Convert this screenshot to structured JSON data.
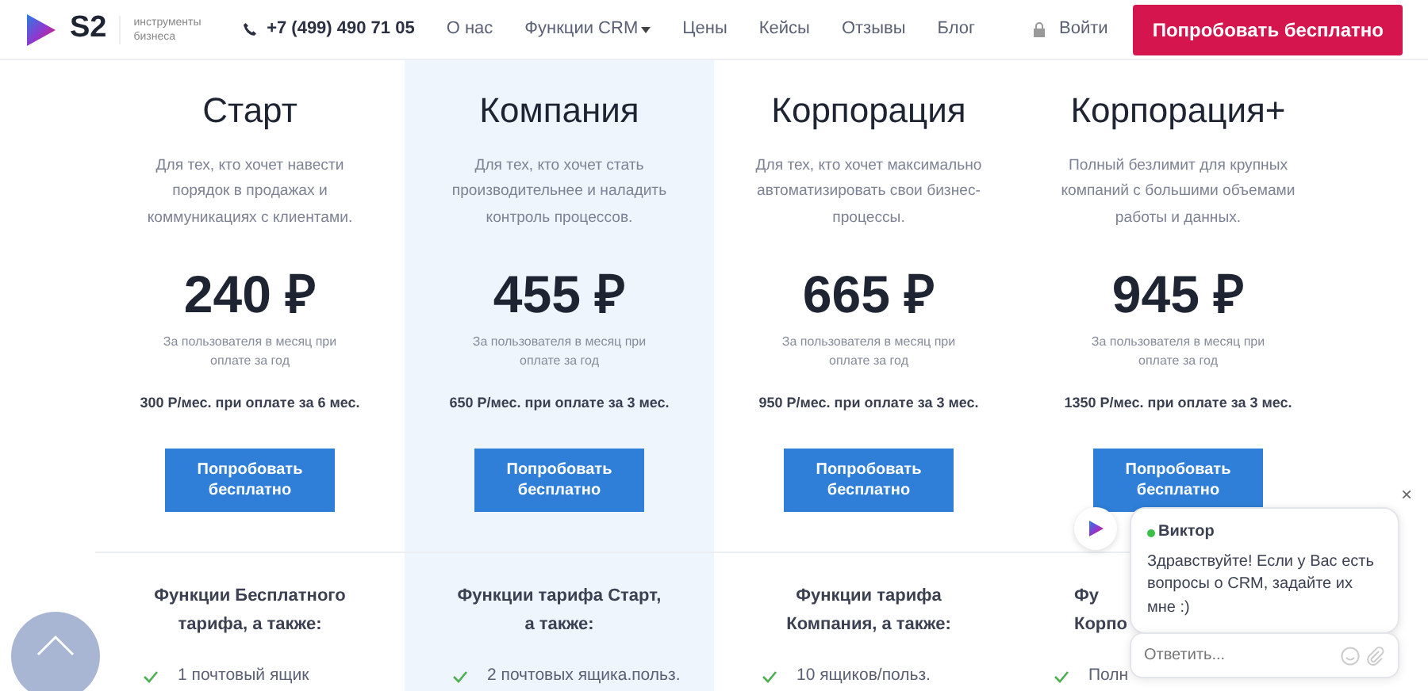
{
  "header": {
    "logo_text": "S2",
    "tagline": "инструменты бизнеса",
    "phone": "+7 (499) 490 71 05",
    "nav": [
      {
        "label": "О нас",
        "dropdown": false
      },
      {
        "label": "Функции CRM",
        "dropdown": true
      },
      {
        "label": "Цены",
        "dropdown": false
      },
      {
        "label": "Кейсы",
        "dropdown": false
      },
      {
        "label": "Отзывы",
        "dropdown": false
      },
      {
        "label": "Блог",
        "dropdown": false
      }
    ],
    "login": "Войти",
    "cta": "Попробовать бесплатно"
  },
  "plans": [
    {
      "name": "Старт",
      "description": "Для тех, кто хочет навести порядок в продажах и коммуникациях с клиентами.",
      "price": "240 ₽",
      "price_note": "За пользователя в месяц при оплате за год",
      "alt_price": "300 Р/мес. при оплате за 6 мес.",
      "button": "Попробовать бесплатно",
      "highlighted": false
    },
    {
      "name": "Компания",
      "description": "Для тех, кто хочет стать производительнее и наладить контроль процессов.",
      "price": "455 ₽",
      "price_note": "За пользователя в месяц при оплате за год",
      "alt_price": "650 Р/мес. при оплате за 3 мес.",
      "button": "Попробовать бесплатно",
      "highlighted": true
    },
    {
      "name": "Корпорация",
      "description": "Для тех, кто хочет максимально автоматизировать свои бизнес-процессы.",
      "price": "665 ₽",
      "price_note": "За пользователя в месяц при оплате за год",
      "alt_price": "950 Р/мес. при оплате за 3 мес.",
      "button": "Попробовать бесплатно",
      "highlighted": false
    },
    {
      "name": "Корпорация+",
      "description": "Полный безлимит для крупных компаний с большими объемами работы и данных.",
      "price": "945 ₽",
      "price_note": "За пользователя в месяц при оплате за год",
      "alt_price": "1350 Р/мес. при оплате за 3 мес.",
      "button": "Попробовать бесплатно",
      "highlighted": false
    }
  ],
  "features": [
    {
      "title_lines": [
        "Функции Бесплатного",
        "тарифа, а также:"
      ],
      "item": "1 почтовый ящик",
      "partial": false
    },
    {
      "title_lines": [
        "Функции тарифа Старт,",
        "а также:"
      ],
      "item": "2 почтовых ящика.польз.",
      "partial": false
    },
    {
      "title_lines": [
        "Функции тарифа",
        "Компания, а также:"
      ],
      "item": "10 ящиков/польз.",
      "partial": false
    },
    {
      "title_lines": [
        "Фу",
        "Корпо"
      ],
      "item": "Полн",
      "partial": true
    }
  ],
  "chat": {
    "agent": "Виктор",
    "online": true,
    "message": "Здравствуйте! Если у Вас есть вопросы о CRM, задайте их мне :)",
    "placeholder": "Ответить...",
    "close": "×"
  }
}
